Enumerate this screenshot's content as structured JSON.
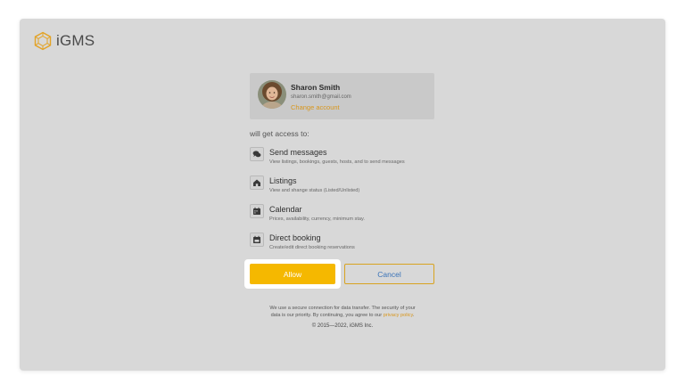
{
  "brand": {
    "name": "iGMS"
  },
  "account": {
    "name": "Sharon Smith",
    "email": "sharon.smith@gmail.com",
    "change_link": "Change account"
  },
  "access_heading": "will get access to:",
  "permissions": [
    {
      "icon": "chat-bubbles-icon",
      "title": "Send messages",
      "description": "View listings, bookings, guests, hosts, and to send messages"
    },
    {
      "icon": "house-icon",
      "title": "Listings",
      "description": "View and shange status (Listed/Unlisted)"
    },
    {
      "icon": "calendar-icon",
      "title": "Calendar",
      "description": "Prices, availability, currency, minimum stay."
    },
    {
      "icon": "calendar-booking-icon",
      "title": "Direct booking",
      "description": "Create/edit direct booking reservations"
    }
  ],
  "buttons": {
    "allow": "Allow",
    "cancel": "Cancel"
  },
  "footer": {
    "security_text_1": "We use a secure connection for data transfer. The security of your",
    "security_text_2": "data is our priority. By continuing, you agree to our ",
    "privacy_link": "privacy policy",
    "period": ".",
    "copyright": "© 2015—2022, iGMS Inc."
  },
  "colors": {
    "accent": "#f5b800",
    "link_orange": "#d8961c",
    "cancel_text": "#3a73b8",
    "panel_bg": "#d8d8d8"
  }
}
